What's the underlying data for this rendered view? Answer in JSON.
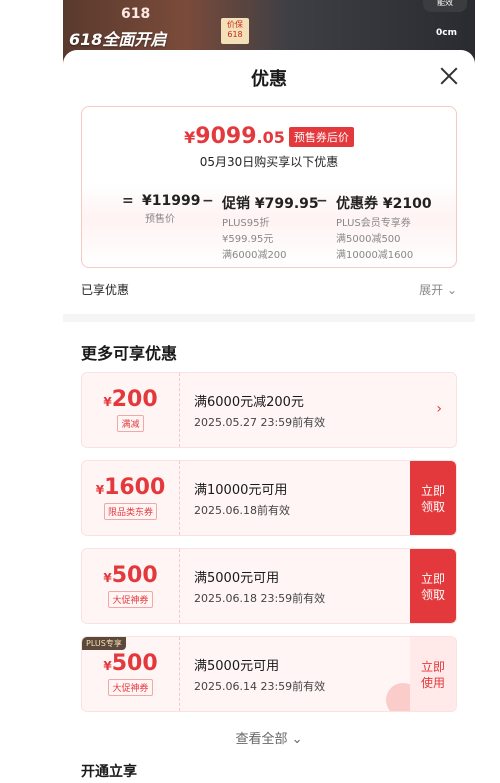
{
  "background": {
    "promo_text": "618全面开启",
    "promo_618": "618",
    "price_tag": "价保618",
    "size_text": "0cm",
    "corner_badge": "能效"
  },
  "sheet": {
    "title": "优惠",
    "close_icon": "close-icon"
  },
  "summary": {
    "final_price_yen": "¥",
    "final_price_int": "9099",
    "final_price_dec": ".05",
    "final_badge": "预售券后价",
    "buy_date": "05月30日购买享以下优惠",
    "equals": "=",
    "minus1": "−",
    "minus2": "−",
    "presale_price": "¥11999",
    "presale_label": "预售价",
    "promo_title": "促销 ¥799.95",
    "promo_sub1": "PLUS95折",
    "promo_sub2": "¥599.95元",
    "promo_sub3": "满6000减200",
    "coupon_title": "优惠券 ¥2100",
    "coupon_sub1": "PLUS会员专享券",
    "coupon_sub2": "满5000减500",
    "coupon_sub3": "满10000减1600"
  },
  "enjoyed": {
    "label": "已享优惠",
    "expand": "展开 ⌄"
  },
  "more_section": {
    "title": "更多可享优惠"
  },
  "coupons": [
    {
      "amount": "200",
      "tag": "满减",
      "condition": "满6000元减200元",
      "date": "2025.05.27 23:59前有效",
      "action": "›",
      "action_type": "arrow"
    },
    {
      "amount": "1600",
      "tag": "限品类东券",
      "condition": "满10000元可用",
      "date": "2025.06.18前有效",
      "action": "立即领取",
      "action_type": "red"
    },
    {
      "amount": "500",
      "tag": "大促神券",
      "condition": "满5000元可用",
      "date": "2025.06.18 23:59前有效",
      "action": "立即领取",
      "action_type": "red"
    },
    {
      "amount": "500",
      "tag": "大促神券",
      "condition": "满5000元可用",
      "date": "2025.06.14 23:59前有效",
      "action": "立即使用",
      "action_type": "light",
      "plus_tag": "PLUS专享"
    }
  ],
  "view_all": "查看全部 ⌄",
  "open_section": {
    "title": "开通立享"
  },
  "colors": {
    "accent": "#e4393c",
    "card_bg": "#fff5f5"
  }
}
